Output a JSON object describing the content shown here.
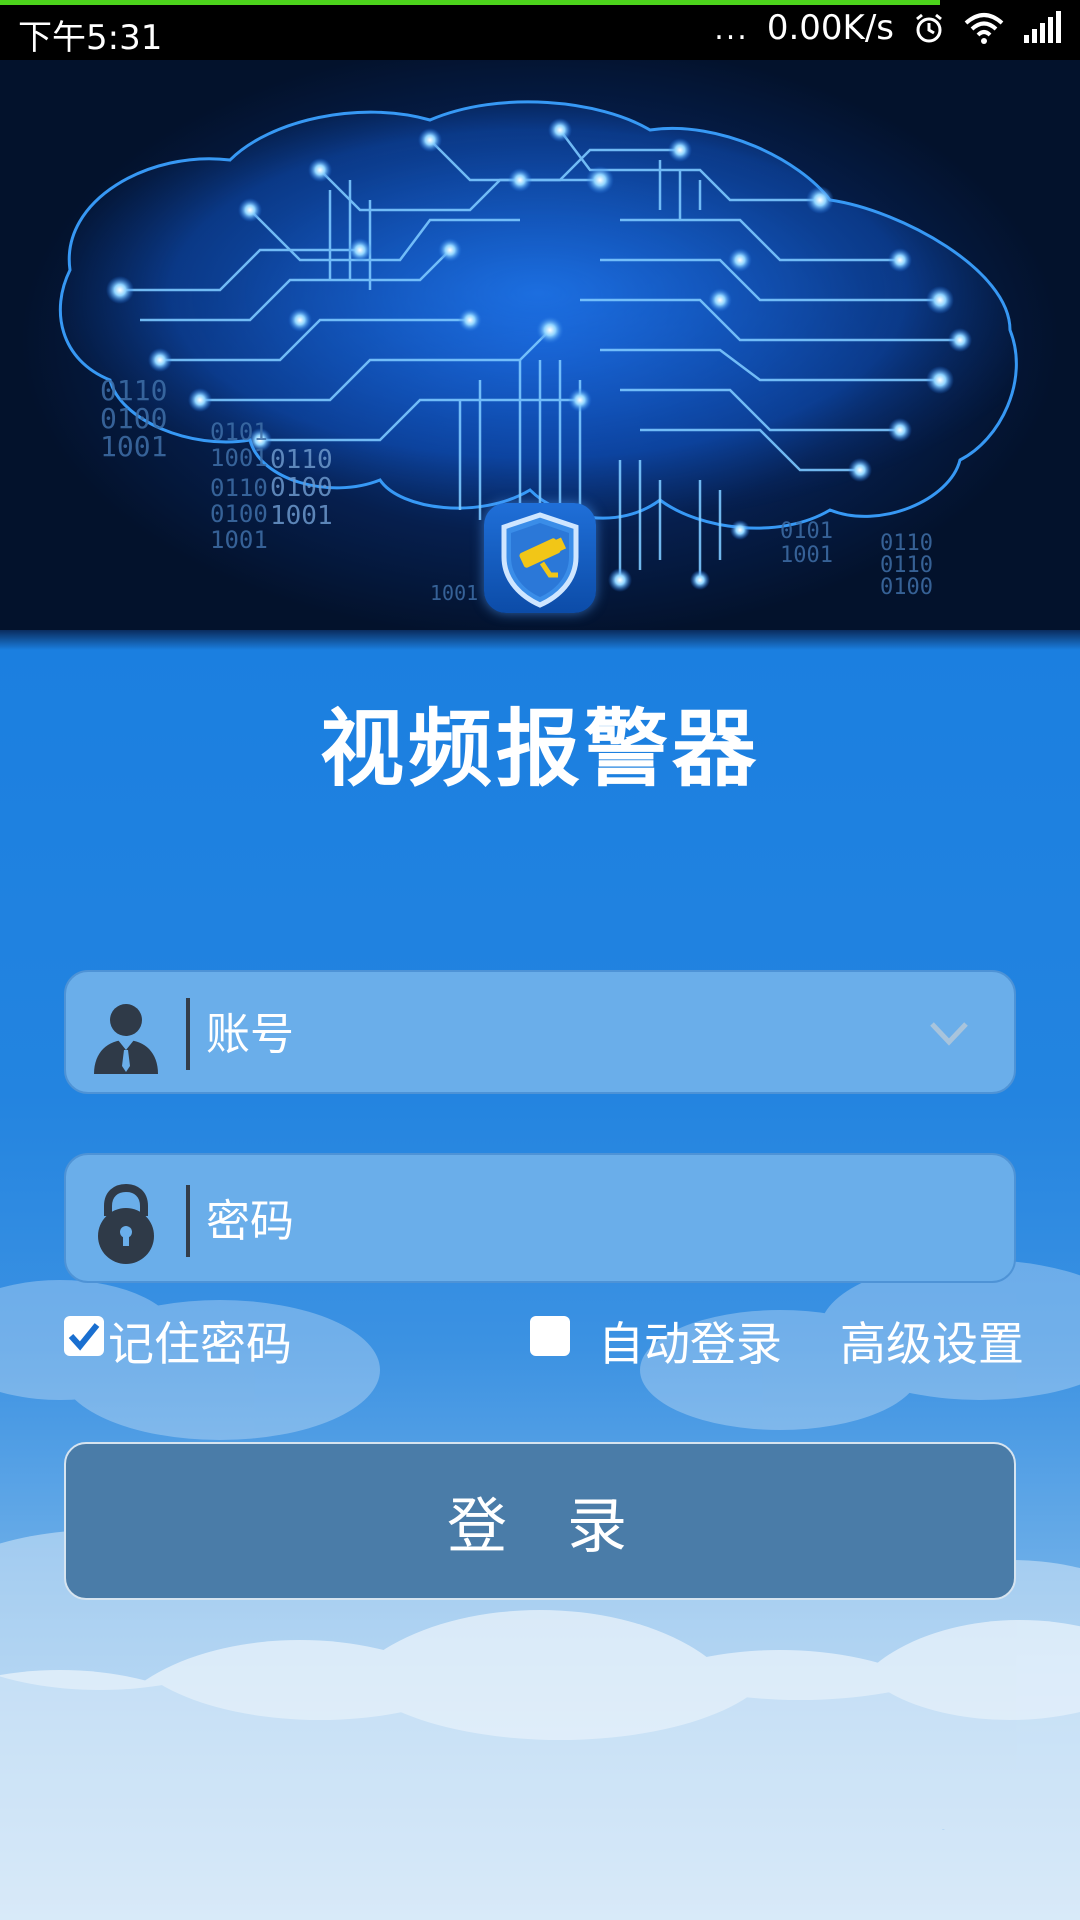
{
  "status_bar": {
    "time": "下午5:31",
    "more": "...",
    "net_speed": "0.00K/s",
    "icons": [
      "alarm-clock-icon",
      "wifi-icon",
      "signal-bars-icon"
    ]
  },
  "hero": {
    "logo_icon": "security-camera-shield-icon",
    "binary_text": [
      "0110",
      "0100",
      "1001",
      "0101",
      "1001",
      "0110",
      "0100",
      "1001",
      "0110",
      "0100",
      "1001",
      "0101",
      "1001",
      "0110",
      "0110",
      "0100",
      "1001"
    ]
  },
  "app": {
    "title": "视频报警器"
  },
  "login_form": {
    "account_placeholder": "账号",
    "password_placeholder": "密码",
    "account_icon": "user-icon",
    "password_icon": "lock-icon",
    "dropdown_icon": "chevron-down-icon",
    "remember_password": {
      "label": "记住密码",
      "checked": true
    },
    "auto_login": {
      "label": "自动登录",
      "checked": false
    },
    "advanced_settings": "高级设置",
    "login_button": "登录"
  },
  "colors": {
    "background": "#1a7fe0",
    "field": "#6aaeea",
    "button": "#4a7ca8",
    "status_accent": "#4cd31c"
  }
}
